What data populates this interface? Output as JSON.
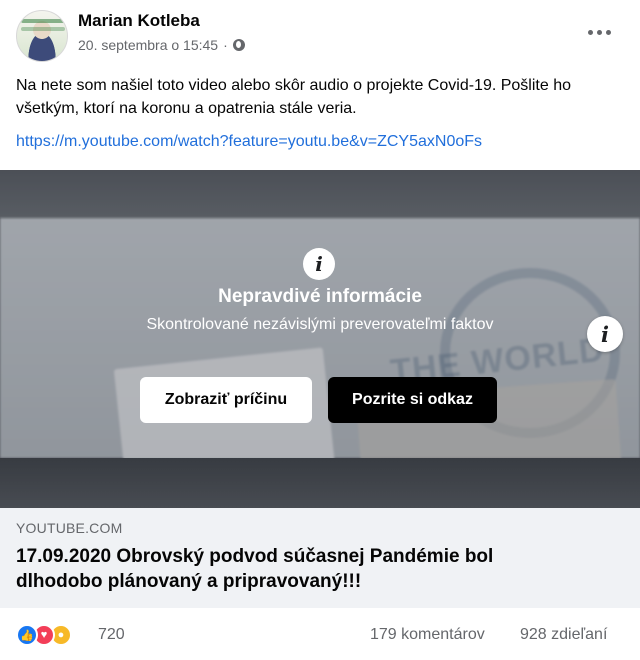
{
  "post": {
    "author": "Marian Kotleba",
    "timestamp": "20. septembra o 15:45",
    "separator": "·",
    "privacy_icon": "globe-icon",
    "text": "Na nete som našiel toto video alebo skôr audio o projekte Covid-19. Pošlite ho všetkým, ktorí na koronu a opatrenia stále veria.",
    "link": "https://m.youtube.com/watch?feature=youtu.be&v=ZCY5axN0oFs"
  },
  "warning": {
    "icon": "i",
    "title": "Nepravdivé informácie",
    "subtitle": "Skontrolované nezávislými preverovateľmi faktov",
    "reason_button": "Zobraziť príčinu",
    "link_button": "Pozrite si odkaz"
  },
  "background_art": {
    "logo_text": "THE WORLD BANK"
  },
  "link_preview": {
    "domain": "YOUTUBE.COM",
    "title": "17.09.2020 Obrovský podvod súčasnej Pandémie bol dlhodobo plánovaný a pripravovaný!!!",
    "info_icon": "i"
  },
  "engagement": {
    "reactions": [
      "like",
      "love",
      "wow"
    ],
    "reaction_count": "720",
    "comments": "179 komentárov",
    "shares": "928 zdieľaní"
  },
  "colors": {
    "link": "#216fdb",
    "secondary_text": "#65676b",
    "like": "#1877f2",
    "love": "#f33e58",
    "wow": "#f7b928"
  }
}
